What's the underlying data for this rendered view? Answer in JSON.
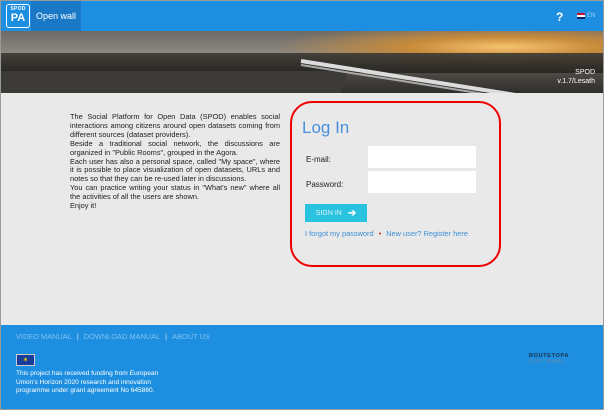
{
  "topbar": {
    "logo_top": "SPOD",
    "logo_bottom": "PA",
    "nav_open_wall": "Open wall",
    "help": "?",
    "language": "EN"
  },
  "hero": {
    "app_name": "SPOD",
    "version": "v.1.7/Lesath"
  },
  "intro": {
    "paragraphs": [
      "The Social Platform for Open Data (SPOD) enables social interactions among citizens around open datasets coming from different sources (dataset providers).",
      "Beside a traditional social network, the discussions are organized in \"Public Rooms\", grouped in the Agora.",
      "Each user has also a personal space, called \"My space\", where it is possible to place visualization of open datasets, URLs and notes so that they can be re-used later in discussions.",
      "You can practice writing your status in \"What's new\" where all the activities of all the users are shown.",
      "Enjoy it!"
    ]
  },
  "login": {
    "title": "Log In",
    "email_label": "E-mail:",
    "email_value": "",
    "password_label": "Password:",
    "password_value": "",
    "signin_label": "SIGN IN",
    "forgot_password": "I forgot my password",
    "register": "New user? Register here"
  },
  "footer": {
    "video_manual": "VIDEO MANUAL",
    "download_manual": "DOWNLOAD MANUAL",
    "about_us": "ABOUT US",
    "separator": "|",
    "funding": "This project has received funding from European Union's Horizon 2020 research and innovation programme under grant agreement No 645860.",
    "brand_a": "ROUTETOPA",
    "brand_b": "SOFTWARE"
  },
  "colors": {
    "primary": "#1e8fe0",
    "accent": "#29c3df",
    "highlight_ring": "#e00000"
  }
}
